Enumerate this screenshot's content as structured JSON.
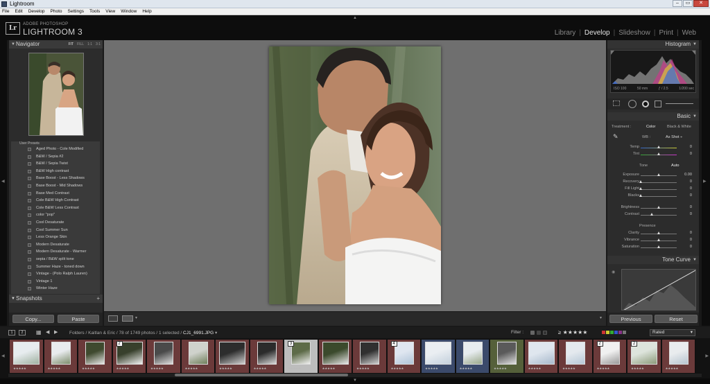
{
  "window": {
    "title": "Lightroom",
    "buttons": [
      "–",
      "▭",
      "✕"
    ]
  },
  "menu": [
    "File",
    "Edit",
    "Develop",
    "Photo",
    "Settings",
    "Tools",
    "View",
    "Window",
    "Help"
  ],
  "identity": {
    "logo": "Lr",
    "line1": "ADOBE PHOTOSHOP",
    "line2": "LIGHTROOM 3"
  },
  "modules": [
    {
      "label": "Library",
      "active": false
    },
    {
      "label": "Develop",
      "active": true
    },
    {
      "label": "Slideshow",
      "active": false
    },
    {
      "label": "Print",
      "active": false
    },
    {
      "label": "Web",
      "active": false
    }
  ],
  "navigator": {
    "title": "Navigator",
    "zoom": [
      "FIT",
      "FILL",
      "1:1",
      "3:1"
    ]
  },
  "presets": {
    "group": "User Presets",
    "items": [
      "Aged Photo - Cole Modified",
      "B&W / Sepia #2",
      "B&W / Sepia Twist",
      "B&W High contrast",
      "Base Boost - Less Shadows",
      "Base Boost - Mid Shadows",
      "Base Med Contrast",
      "Cole B&W High Contrast",
      "Cole B&W Less Contrast",
      "color \"pop\"",
      "Cool Desaturate",
      "Cool Summer Sun",
      "Less Orange Skin",
      "Modern Desaturate",
      "Modern Desaturate - Warmer",
      "sepia / B&W split tone",
      "Summer Haze - toned down",
      "Vintage - (Polo Ralph Lauren)",
      "Vintage 1",
      "Winter Haze"
    ]
  },
  "snapshots": {
    "title": "Snapshots",
    "plus": "+"
  },
  "left_buttons": {
    "copy": "Copy...",
    "paste": "Paste"
  },
  "histogram": {
    "title": "Histogram",
    "iso": "ISO 100",
    "focal": "50 mm",
    "aperture": "ƒ / 2.5",
    "shutter": "1/200 sec"
  },
  "basic": {
    "title": "Basic",
    "treatment_label": "Treatment :",
    "treatment_color": "Color",
    "treatment_bw": "Black & White",
    "wb_label": "WB :",
    "wb_value": "As Shot ÷",
    "tone_label": "Tone",
    "tone_auto": "Auto",
    "presence_label": "Presence",
    "sliders": [
      {
        "label": "Temp",
        "value": "0",
        "pos": 0.5
      },
      {
        "label": "Tint",
        "value": "0",
        "pos": 0.5
      },
      {
        "label": "Exposure",
        "value": "0.00",
        "pos": 0.5
      },
      {
        "label": "Recovery",
        "value": "0",
        "pos": 0.0
      },
      {
        "label": "Fill Light",
        "value": "0",
        "pos": 0.0
      },
      {
        "label": "Blacks",
        "value": "0",
        "pos": 0.0
      },
      {
        "label": "Brightness",
        "value": "0",
        "pos": 0.5
      },
      {
        "label": "Contrast",
        "value": "0",
        "pos": 0.3
      },
      {
        "label": "Clarity",
        "value": "0",
        "pos": 0.5
      },
      {
        "label": "Vibrance",
        "value": "0",
        "pos": 0.5
      },
      {
        "label": "Saturation",
        "value": "0",
        "pos": 0.5
      }
    ]
  },
  "tone_curve": {
    "title": "Tone Curve"
  },
  "right_buttons": {
    "previous": "Previous",
    "reset": "Reset"
  },
  "filmstrip_bar": {
    "page1": "1",
    "page2": "2",
    "path_prefix": "Folders / Kaitlan & Eric / 78 of 1749 photos / 1 selected /",
    "filename": "CJ1_6991.JPG",
    "filter_label": "Filter :",
    "stars": "≥ ★★★★★",
    "rated": "Rated"
  },
  "filmstrip": {
    "stars": "★★★★★",
    "cells": [
      {
        "badge": "",
        "tint": "#6b3a3a",
        "selected": false
      },
      {
        "badge": "",
        "tint": "#6b3a3a",
        "selected": false
      },
      {
        "badge": "",
        "tint": "#6b3a3a",
        "selected": false
      },
      {
        "badge": "2",
        "tint": "#6b3a3a",
        "selected": false
      },
      {
        "badge": "",
        "tint": "#6b3a3a",
        "selected": false
      },
      {
        "badge": "",
        "tint": "#6b3a3a",
        "selected": false
      },
      {
        "badge": "",
        "tint": "#6b3a3a",
        "selected": false
      },
      {
        "badge": "",
        "tint": "#6b3a3a",
        "selected": false
      },
      {
        "badge": "3",
        "tint": "#bdbdbd",
        "selected": true
      },
      {
        "badge": "",
        "tint": "#6b3a3a",
        "selected": false
      },
      {
        "badge": "",
        "tint": "#6b3a3a",
        "selected": false
      },
      {
        "badge": "4",
        "tint": "#6b3a3a",
        "selected": false
      },
      {
        "badge": "",
        "tint": "#3b4a6b",
        "selected": false
      },
      {
        "badge": "",
        "tint": "#3b4a6b",
        "selected": false
      },
      {
        "badge": "",
        "tint": "#55603a",
        "selected": false
      },
      {
        "badge": "",
        "tint": "#6b3a3a",
        "selected": false
      },
      {
        "badge": "",
        "tint": "#6b3a3a",
        "selected": false
      },
      {
        "badge": "2",
        "tint": "#6b3a3a",
        "selected": false
      },
      {
        "badge": "2",
        "tint": "#6b3a3a",
        "selected": false
      },
      {
        "badge": "",
        "tint": "#6b3a3a",
        "selected": false
      }
    ]
  }
}
